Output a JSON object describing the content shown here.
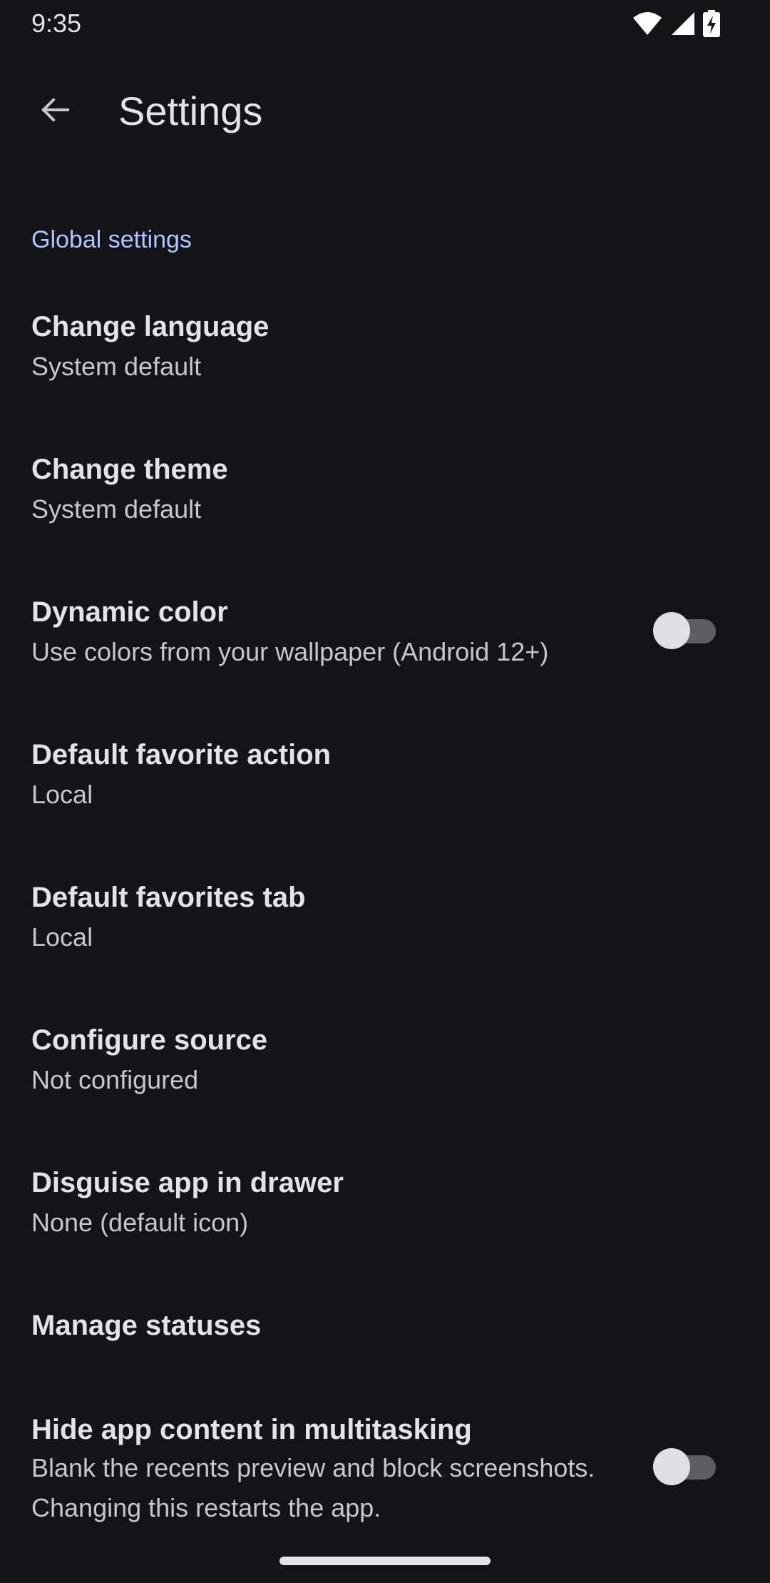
{
  "status_bar": {
    "time": "9:35",
    "icons": [
      "wifi-icon",
      "cellular-signal-icon",
      "battery-charging-icon"
    ]
  },
  "app_bar": {
    "title": "Settings",
    "back_icon": "arrow-back-icon"
  },
  "section": {
    "header": "Global settings"
  },
  "settings": [
    {
      "title": "Change language",
      "summary": "System default"
    },
    {
      "title": "Change theme",
      "summary": "System default"
    },
    {
      "title": "Dynamic color",
      "summary": "Use colors from your wallpaper (Android 12+)",
      "switch_on": false
    },
    {
      "title": "Default favorite action",
      "summary": "Local"
    },
    {
      "title": "Default favorites tab",
      "summary": "Local"
    },
    {
      "title": "Configure source",
      "summary": "Not configured"
    },
    {
      "title": "Disguise app in drawer",
      "summary": "None (default icon)"
    },
    {
      "title": "Manage statuses"
    },
    {
      "title": "Hide app content in multitasking",
      "summary": "Blank the recents preview and block screenshots. Changing this restarts the app.",
      "switch_on": false
    }
  ],
  "colors": {
    "background": "#131318",
    "accent": "#aec6ff",
    "text_primary": "#e4e1e9",
    "text_secondary": "#c6c5d0"
  }
}
